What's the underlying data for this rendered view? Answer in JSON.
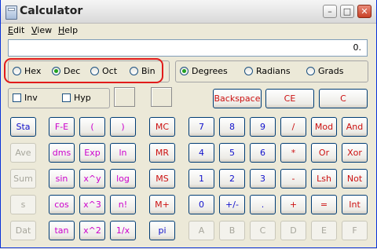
{
  "window": {
    "title": "Calculator",
    "controls": {
      "minimize": "–",
      "maximize": "□",
      "close": "✕"
    }
  },
  "menu": [
    {
      "label": "Edit",
      "accel": "E",
      "rest": "dit"
    },
    {
      "label": "View",
      "accel": "V",
      "rest": "iew"
    },
    {
      "label": "Help",
      "accel": "H",
      "rest": "elp"
    }
  ],
  "display": {
    "value": "0."
  },
  "number_base": {
    "options": [
      "Hex",
      "Dec",
      "Oct",
      "Bin"
    ],
    "selected": "Dec"
  },
  "angle_units": {
    "options": [
      "Degrees",
      "Radians",
      "Grads"
    ],
    "selected": "Degrees"
  },
  "modifiers": {
    "inv": "Inv",
    "hyp": "Hyp"
  },
  "edit_buttons": {
    "backspace": "Backspace",
    "ce": "CE",
    "c": "C"
  },
  "stat_buttons": [
    "Sta",
    "Ave",
    "Sum",
    "s",
    "Dat"
  ],
  "function_buttons": [
    [
      "F-E",
      "(",
      ")"
    ],
    [
      "dms",
      "Exp",
      "ln"
    ],
    [
      "sin",
      "x^y",
      "log"
    ],
    [
      "cos",
      "x^3",
      "n!"
    ],
    [
      "tan",
      "x^2",
      "1/x"
    ]
  ],
  "memory_buttons": [
    "MC",
    "MR",
    "MS",
    "M+",
    "pi"
  ],
  "keypad": [
    [
      "7",
      "8",
      "9",
      "/",
      "Mod",
      "And"
    ],
    [
      "4",
      "5",
      "6",
      "*",
      "Or",
      "Xor"
    ],
    [
      "1",
      "2",
      "3",
      "-",
      "Lsh",
      "Not"
    ],
    [
      "0",
      "+/-",
      ".",
      "+",
      "=",
      "Int"
    ],
    [
      "A",
      "B",
      "C",
      "D",
      "E",
      "F"
    ]
  ],
  "colors": {
    "blue": "#1111cc",
    "red": "#cc1111",
    "magenta": "#cc00cc",
    "disabled": "#a7a69c",
    "highlight": "#e11b1b"
  }
}
